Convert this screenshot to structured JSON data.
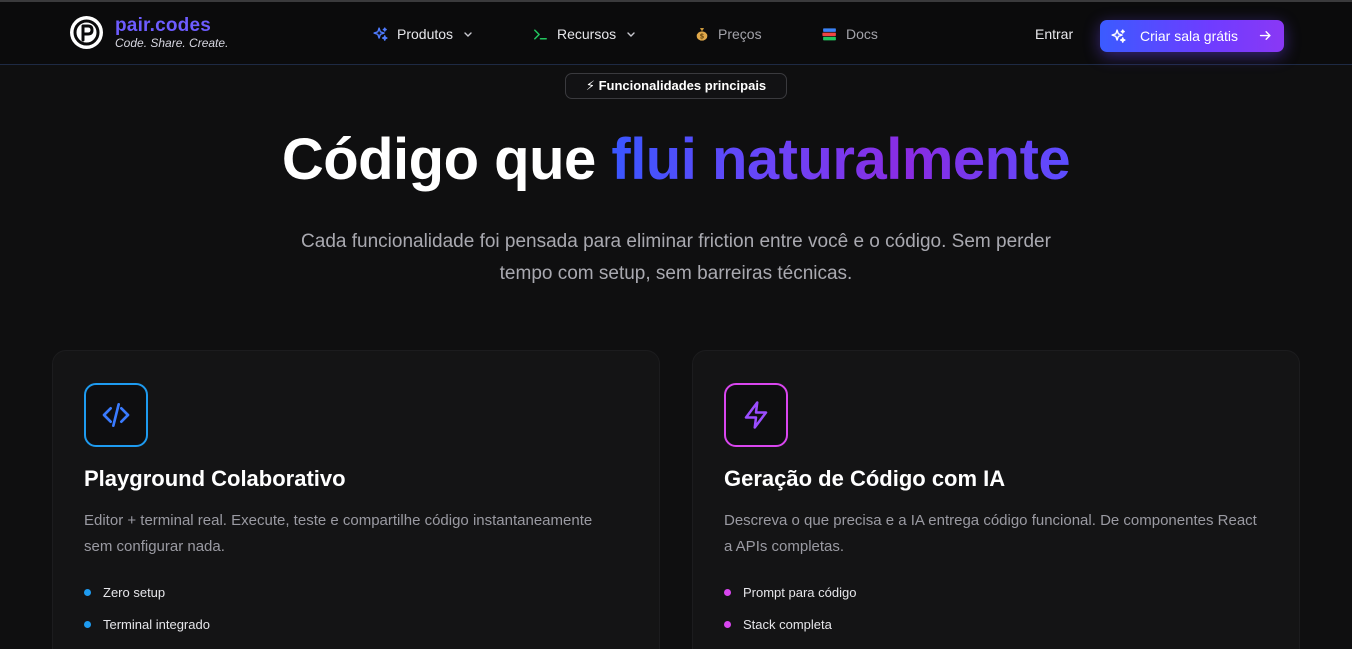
{
  "header": {
    "brand_name": "pair.codes",
    "brand_tagline": "Code. Share. Create.",
    "nav": [
      {
        "label": "Produtos",
        "icon": "sparkles-icon",
        "has_dropdown": true
      },
      {
        "label": "Recursos",
        "icon": "terminal-icon",
        "has_dropdown": true
      },
      {
        "label": "Preços",
        "icon": "money-bag-icon",
        "has_dropdown": false
      },
      {
        "label": "Docs",
        "icon": "books-icon",
        "has_dropdown": false
      }
    ],
    "login_label": "Entrar",
    "cta_label": "Criar sala grátis"
  },
  "hero": {
    "badge": "⚡ Funcionalidades principais",
    "title_plain": "Código que ",
    "title_highlight": "flui naturalmente",
    "subtitle": "Cada funcionalidade foi pensada para eliminar friction entre você e o código. Sem perder tempo com setup, sem barreiras técnicas."
  },
  "features": [
    {
      "icon": "code-icon",
      "accent": "#1e9bf0",
      "title": "Playground Colaborativo",
      "description": "Editor + terminal real. Execute, teste e compartilhe código instantaneamente sem configurar nada.",
      "bullets": [
        "Zero setup",
        "Terminal integrado"
      ]
    },
    {
      "icon": "lightning-icon",
      "accent": "#d946ef",
      "title": "Geração de Código com IA",
      "description": "Descreva o que precisa e a IA entrega código funcional. De componentes React a APIs completas.",
      "bullets": [
        "Prompt para código",
        "Stack completa"
      ]
    }
  ],
  "colors": {
    "background": "#0f0f10",
    "brand": "#6d5cff",
    "gradient_start": "#3a56ff",
    "gradient_end": "#8a2be2"
  }
}
